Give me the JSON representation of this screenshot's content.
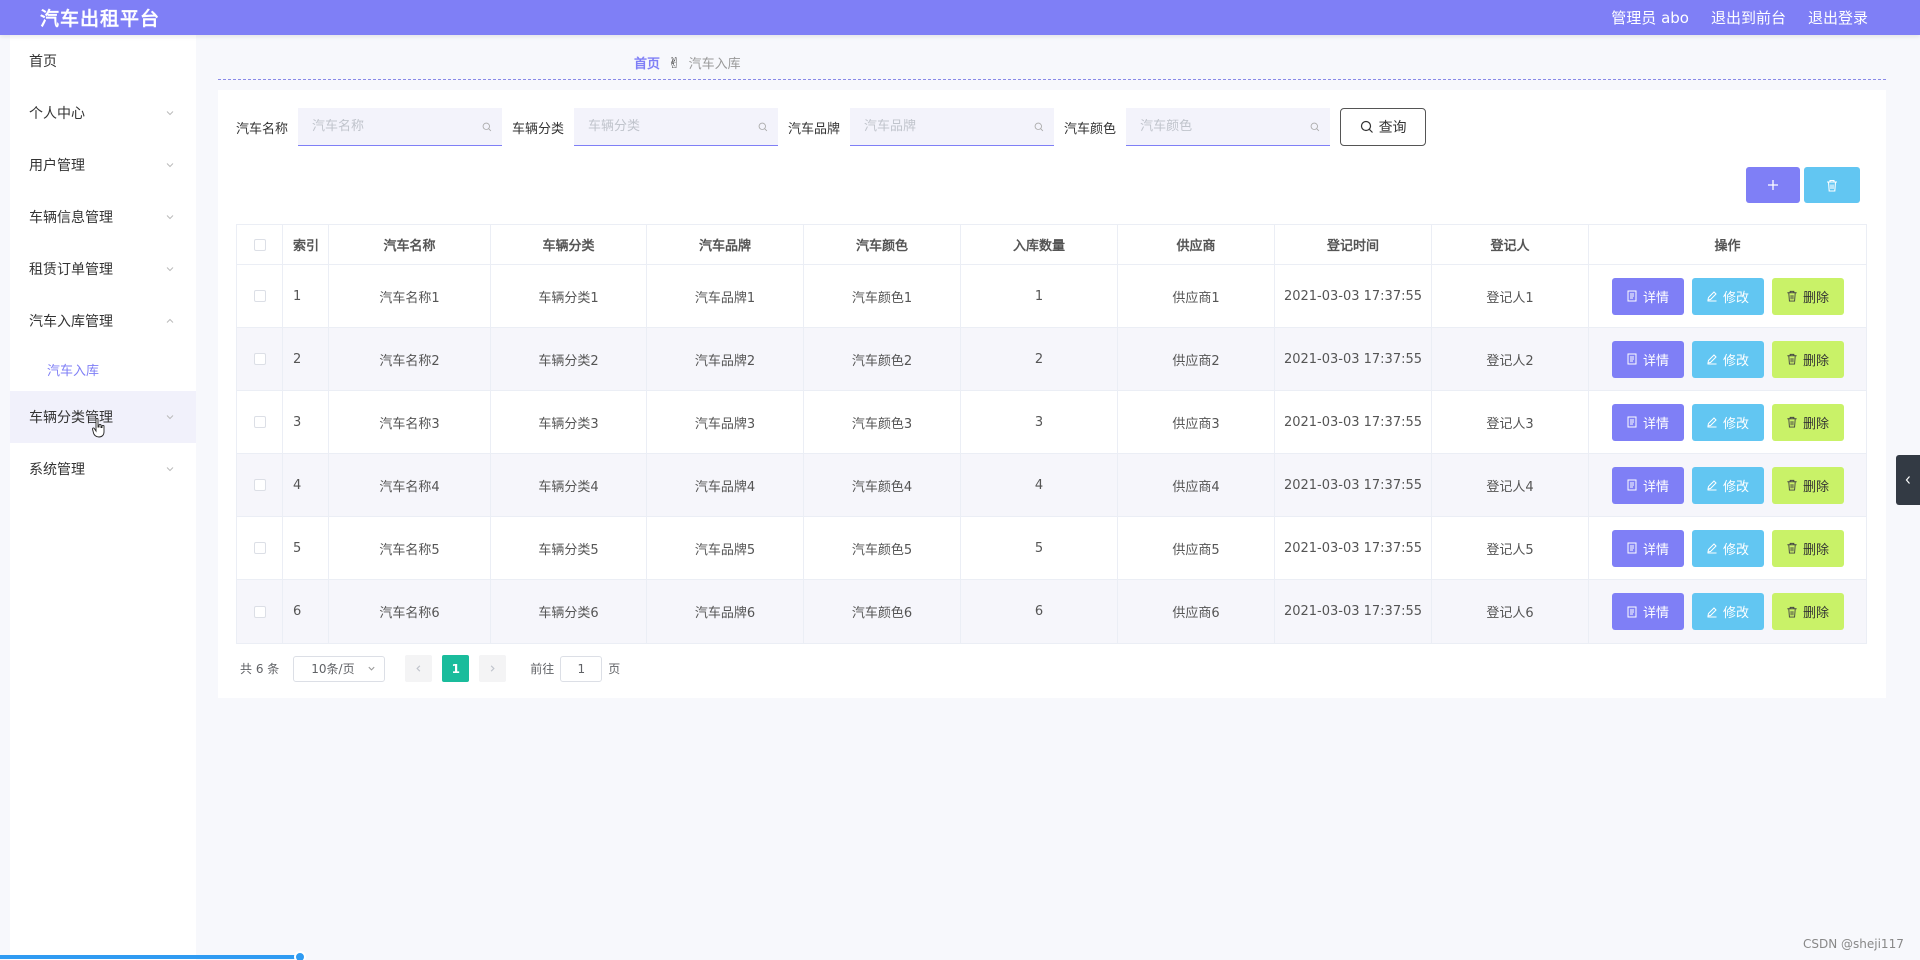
{
  "header": {
    "brand": "汽车出租平台",
    "admin_label": "管理员 abo",
    "front_label": "退出到前台",
    "logout_label": "退出登录"
  },
  "sidebar": {
    "items": [
      {
        "label": "首页"
      },
      {
        "label": "个人中心"
      },
      {
        "label": "用户管理"
      },
      {
        "label": "车辆信息管理"
      },
      {
        "label": "租赁订单管理"
      },
      {
        "label": "汽车入库管理"
      },
      {
        "label": "车辆分类管理"
      },
      {
        "label": "系统管理"
      }
    ],
    "sub_item": "汽车入库"
  },
  "breadcrumb": {
    "home": "首页",
    "current": "汽车入库"
  },
  "search": {
    "name_label": "汽车名称",
    "name_placeholder": "汽车名称",
    "class_label": "车辆分类",
    "class_placeholder": "车辆分类",
    "brand_label": "汽车品牌",
    "brand_placeholder": "汽车品牌",
    "color_label": "汽车颜色",
    "color_placeholder": "汽车颜色",
    "query_label": "查询"
  },
  "table": {
    "headers": [
      "索引",
      "汽车名称",
      "车辆分类",
      "汽车品牌",
      "汽车颜色",
      "入库数量",
      "供应商",
      "登记时间",
      "登记人",
      "操作"
    ],
    "rows": [
      {
        "idx": "1",
        "name": "汽车名称1",
        "cls": "车辆分类1",
        "brand": "汽车品牌1",
        "color": "汽车颜色1",
        "qty": "1",
        "sup": "供应商1",
        "time": "2021-03-03 17:37:55",
        "reg": "登记人1"
      },
      {
        "idx": "2",
        "name": "汽车名称2",
        "cls": "车辆分类2",
        "brand": "汽车品牌2",
        "color": "汽车颜色2",
        "qty": "2",
        "sup": "供应商2",
        "time": "2021-03-03 17:37:55",
        "reg": "登记人2"
      },
      {
        "idx": "3",
        "name": "汽车名称3",
        "cls": "车辆分类3",
        "brand": "汽车品牌3",
        "color": "汽车颜色3",
        "qty": "3",
        "sup": "供应商3",
        "time": "2021-03-03 17:37:55",
        "reg": "登记人3"
      },
      {
        "idx": "4",
        "name": "汽车名称4",
        "cls": "车辆分类4",
        "brand": "汽车品牌4",
        "color": "汽车颜色4",
        "qty": "4",
        "sup": "供应商4",
        "time": "2021-03-03 17:37:55",
        "reg": "登记人4"
      },
      {
        "idx": "5",
        "name": "汽车名称5",
        "cls": "车辆分类5",
        "brand": "汽车品牌5",
        "color": "汽车颜色5",
        "qty": "5",
        "sup": "供应商5",
        "time": "2021-03-03 17:37:55",
        "reg": "登记人5"
      },
      {
        "idx": "6",
        "name": "汽车名称6",
        "cls": "车辆分类6",
        "brand": "汽车品牌6",
        "color": "汽车颜色6",
        "qty": "6",
        "sup": "供应商6",
        "time": "2021-03-03 17:37:55",
        "reg": "登记人6"
      }
    ],
    "ops": {
      "detail": "详情",
      "edit": "修改",
      "delete": "删除"
    }
  },
  "pagination": {
    "total": "共 6 条",
    "page_size": "10条/页",
    "current_page": "1",
    "goto_label": "前往",
    "goto_value": "1",
    "page_unit": "页"
  },
  "watermark": "CSDN @sheji117",
  "colors": {
    "primary": "#7f7ff6",
    "info": "#62c6f2",
    "danger": "#c9f268",
    "page_active": "#1abc9c"
  }
}
